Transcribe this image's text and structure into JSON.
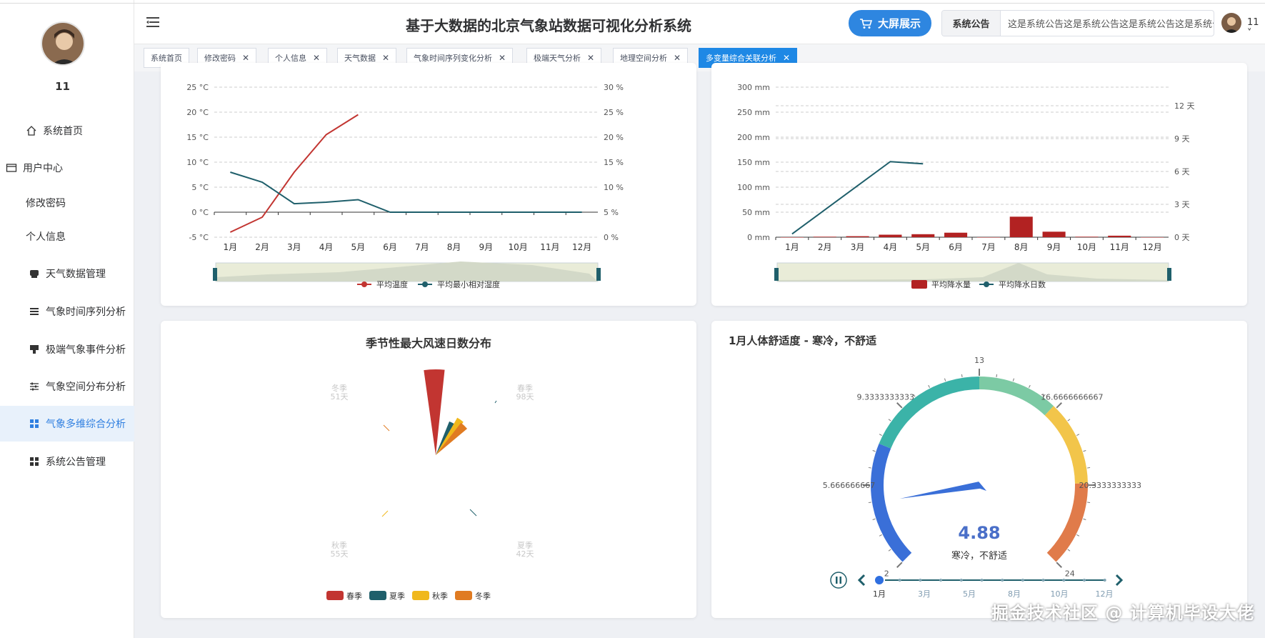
{
  "user": {
    "name": "11"
  },
  "sidebar": {
    "items": [
      {
        "label": "系统首页"
      },
      {
        "label": "用户中心"
      },
      {
        "label": "修改密码"
      },
      {
        "label": "个人信息"
      },
      {
        "label": "天气数据管理"
      },
      {
        "label": "气象时间序列分析"
      },
      {
        "label": "极端气象事件分析"
      },
      {
        "label": "气象空间分布分析"
      },
      {
        "label": "气象多维综合分析"
      },
      {
        "label": "系统公告管理"
      }
    ]
  },
  "header": {
    "title": "基于大数据的北京气象站数据可视化分析系统",
    "bigscreen_label": "大屏展示",
    "notice_label": "系统公告",
    "notice_text": "这是系统公告这是系统公告这是系统公告这是系统公告",
    "user_name": "11 ˅"
  },
  "tabs": [
    {
      "label": "系统首页"
    },
    {
      "label": "修改密码"
    },
    {
      "label": "个人信息"
    },
    {
      "label": "天气数据"
    },
    {
      "label": "气象时间序列变化分析"
    },
    {
      "label": "极端天气分析"
    },
    {
      "label": "地理空间分析"
    },
    {
      "label": "多变量综合关联分析"
    }
  ],
  "colors": {
    "accent": "#1e88e5",
    "red": "#c23531",
    "teal": "#1f5f6b",
    "yellow": "#f0b81c",
    "orange": "#e07b22"
  },
  "chart_data": [
    {
      "type": "line",
      "categories": [
        "1月",
        "2月",
        "3月",
        "4月",
        "5月",
        "6月",
        "7月",
        "8月",
        "9月",
        "10月",
        "11月",
        "12月"
      ],
      "yaxis_left": {
        "labels": [
          "25 °C",
          "20 °C",
          "15 °C",
          "10 °C",
          "5 °C",
          "0 °C",
          "-5 °C"
        ],
        "range": [
          -5,
          25
        ]
      },
      "yaxis_right": {
        "labels": [
          "30 %",
          "25 %",
          "20 %",
          "15 %",
          "10 %",
          "5 %",
          "0 %"
        ],
        "range": [
          0,
          30
        ]
      },
      "series": [
        {
          "name": "平均温度",
          "axis": "left",
          "values": [
            -4,
            -1,
            8,
            15.5,
            19.5
          ]
        },
        {
          "name": "平均最小相对湿度",
          "axis": "right",
          "values": [
            13,
            11,
            6.7,
            7,
            7.5,
            5,
            5,
            5,
            5,
            5,
            5,
            5
          ]
        }
      ],
      "legend": [
        "平均温度",
        "平均最小相对湿度"
      ]
    },
    {
      "type": "bar",
      "categories": [
        "1月",
        "2月",
        "3月",
        "4月",
        "5月",
        "6月",
        "7月",
        "8月",
        "9月",
        "10月",
        "11月",
        "12月"
      ],
      "yaxis_left": {
        "labels": [
          "300 mm",
          "250 mm",
          "200 mm",
          "150 mm",
          "100 mm",
          "50 mm",
          "0 mm"
        ],
        "range": [
          0,
          300
        ]
      },
      "yaxis_right": {
        "labels": [
          "12 天",
          "9 天",
          "6 天",
          "3 天",
          "0 天"
        ],
        "range": [
          0,
          13.7
        ]
      },
      "series": [
        {
          "name": "平均降水量",
          "kind": "bar",
          "values": [
            0,
            1,
            2,
            5,
            6,
            9,
            0,
            41,
            11,
            1,
            3,
            0
          ]
        },
        {
          "name": "平均降水日数",
          "kind": "line",
          "values": [
            0.3,
            2.5,
            4.7,
            6.9,
            6.7
          ]
        }
      ],
      "legend": [
        "平均降水量",
        "平均降水日数"
      ]
    },
    {
      "type": "pie",
      "title": "季节性最大风速日数分布",
      "categories": [
        "春季",
        "夏季",
        "秋季",
        "冬季"
      ],
      "values": [
        98,
        42,
        55,
        51
      ],
      "labels": [
        {
          "season": "冬季",
          "days": "51天"
        },
        {
          "season": "春季",
          "days": "98天"
        },
        {
          "season": "秋季",
          "days": "55天"
        },
        {
          "season": "夏季",
          "days": "42天"
        }
      ],
      "legend": [
        "春季",
        "夏季",
        "秋季",
        "冬季"
      ]
    },
    {
      "type": "gauge",
      "title": "1月人体舒适度 - 寒冷，不舒适",
      "value": 4.88,
      "value_label": "4.88",
      "status": "寒冷，不舒适",
      "range": [
        2,
        24
      ],
      "ticks": [
        "2",
        "5.666666667",
        "9.3333333333",
        "13",
        "16.6666666667",
        "20.3333333333",
        "24"
      ],
      "timeline": [
        "1月",
        "3月",
        "5月",
        "8月",
        "10月",
        "12月"
      ],
      "timeline_current": "1月"
    }
  ],
  "watermark": "掘金技术社区 @ 计算机毕设大佬"
}
